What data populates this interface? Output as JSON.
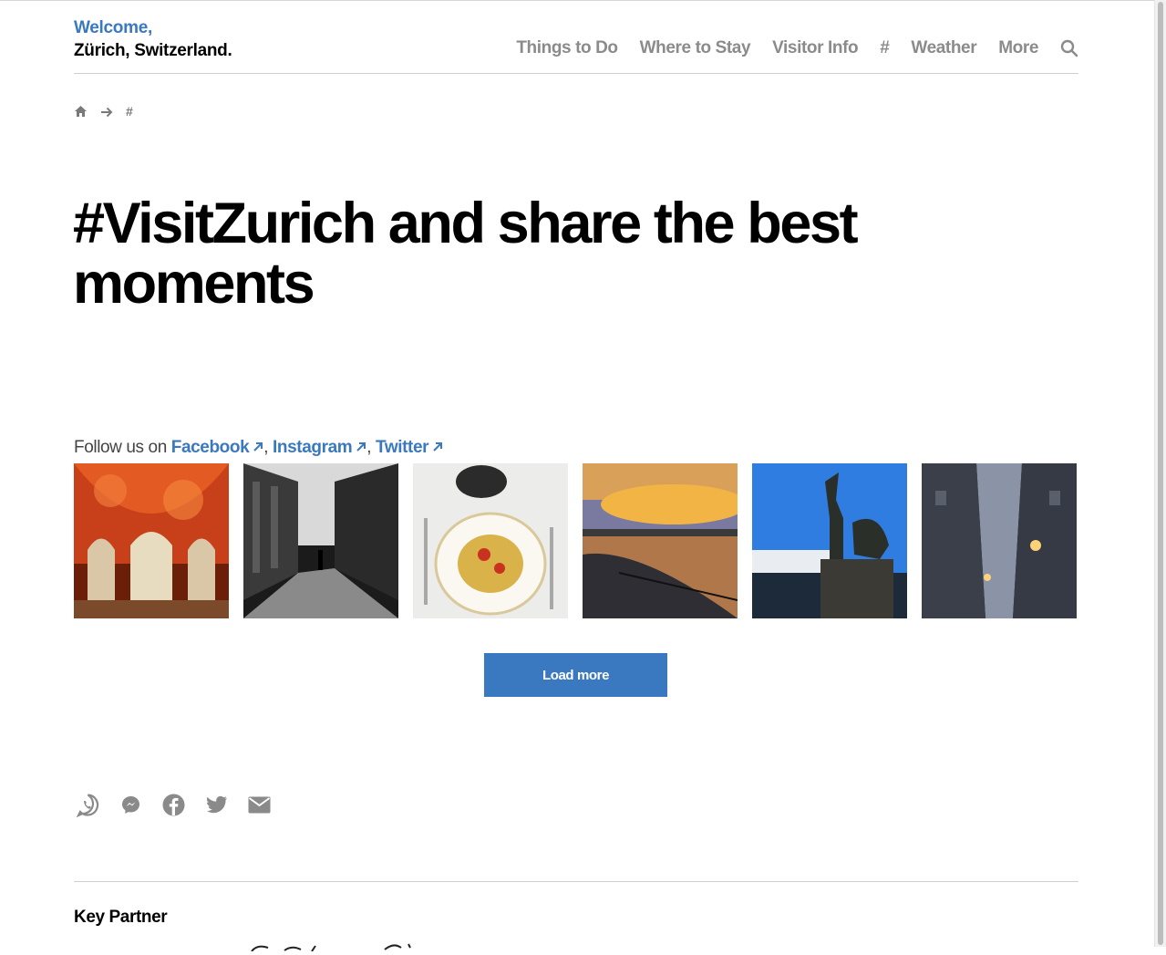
{
  "brand": {
    "welcome": "Welcome,",
    "city": "Zürich, Switzerland."
  },
  "nav": {
    "items": [
      "Things to Do",
      "Where to Stay",
      "Visitor Info",
      "#",
      "Weather",
      "More"
    ],
    "search_icon": "search-icon",
    "color": "#8b8b8b"
  },
  "breadcrumb": {
    "home_icon": "home-icon",
    "separator_icon": "arrow-right-icon",
    "current": "#"
  },
  "page": {
    "title": "#VisitZurich and share the best moments"
  },
  "follow": {
    "prefix": "Follow us on",
    "links": [
      "Facebook",
      "Instagram",
      "Twitter"
    ],
    "separator": ",",
    "link_color": "#3a78bf"
  },
  "gallery": {
    "images": [
      "ornate-red-ceiling-hall-photo",
      "city-street-silhouette-photo",
      "pasta-plate-photo",
      "lake-sunset-photo",
      "statue-and-ship-photo",
      "old-town-alley-night-photo"
    ]
  },
  "load_more": {
    "label": "Load more",
    "color": "#3a78bf"
  },
  "share": {
    "icons": [
      "whatsapp-icon",
      "messenger-icon",
      "facebook-icon",
      "twitter-icon",
      "email-icon"
    ]
  },
  "footer": {
    "key_partner": "Key Partner"
  }
}
